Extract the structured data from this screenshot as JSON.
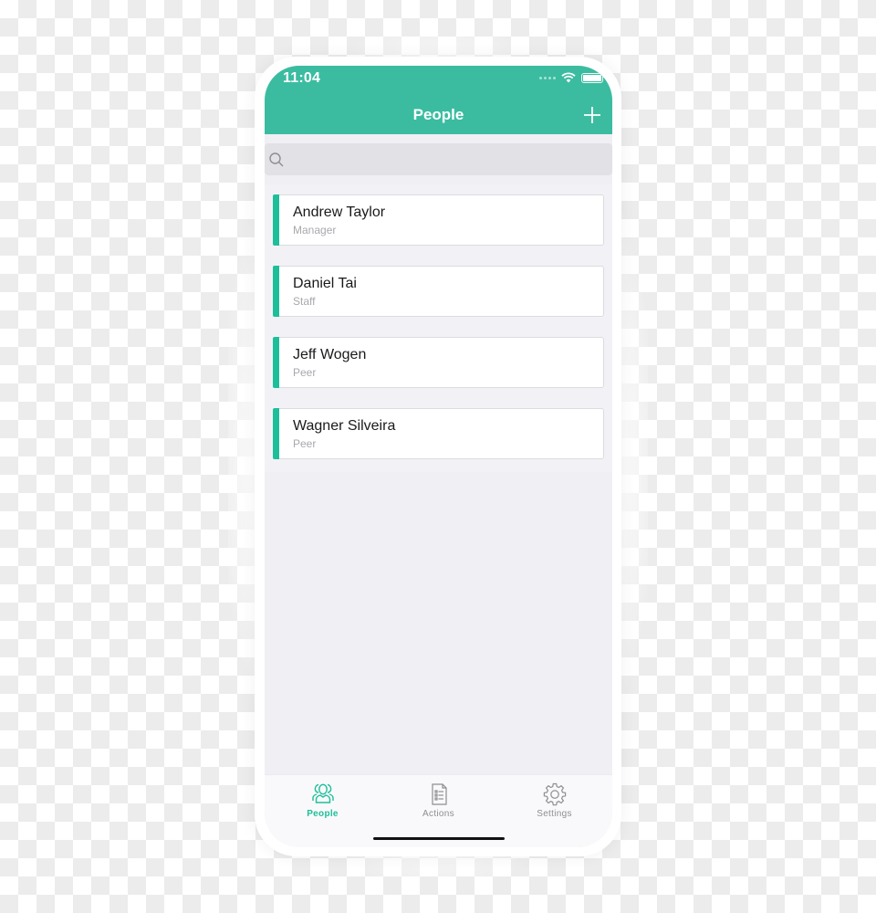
{
  "status_bar": {
    "time": "11:04"
  },
  "nav": {
    "title": "People",
    "add_icon": "plus-icon"
  },
  "search": {
    "placeholder": "",
    "value": "",
    "icon": "search-icon"
  },
  "people": [
    {
      "name": "Andrew Taylor",
      "role": "Manager"
    },
    {
      "name": "Daniel Tai",
      "role": "Staff"
    },
    {
      "name": "Jeff Wogen",
      "role": "Peer"
    },
    {
      "name": "Wagner Silveira",
      "role": "Peer"
    }
  ],
  "tabs": [
    {
      "label": "People",
      "icon": "people-icon",
      "active": true
    },
    {
      "label": "Actions",
      "icon": "document-list-icon",
      "active": false
    },
    {
      "label": "Settings",
      "icon": "gear-icon",
      "active": false
    }
  ],
  "colors": {
    "accent": "#3bbca1",
    "card_accent": "#1dbf9a",
    "inactive_tab": "#8e8e93"
  }
}
